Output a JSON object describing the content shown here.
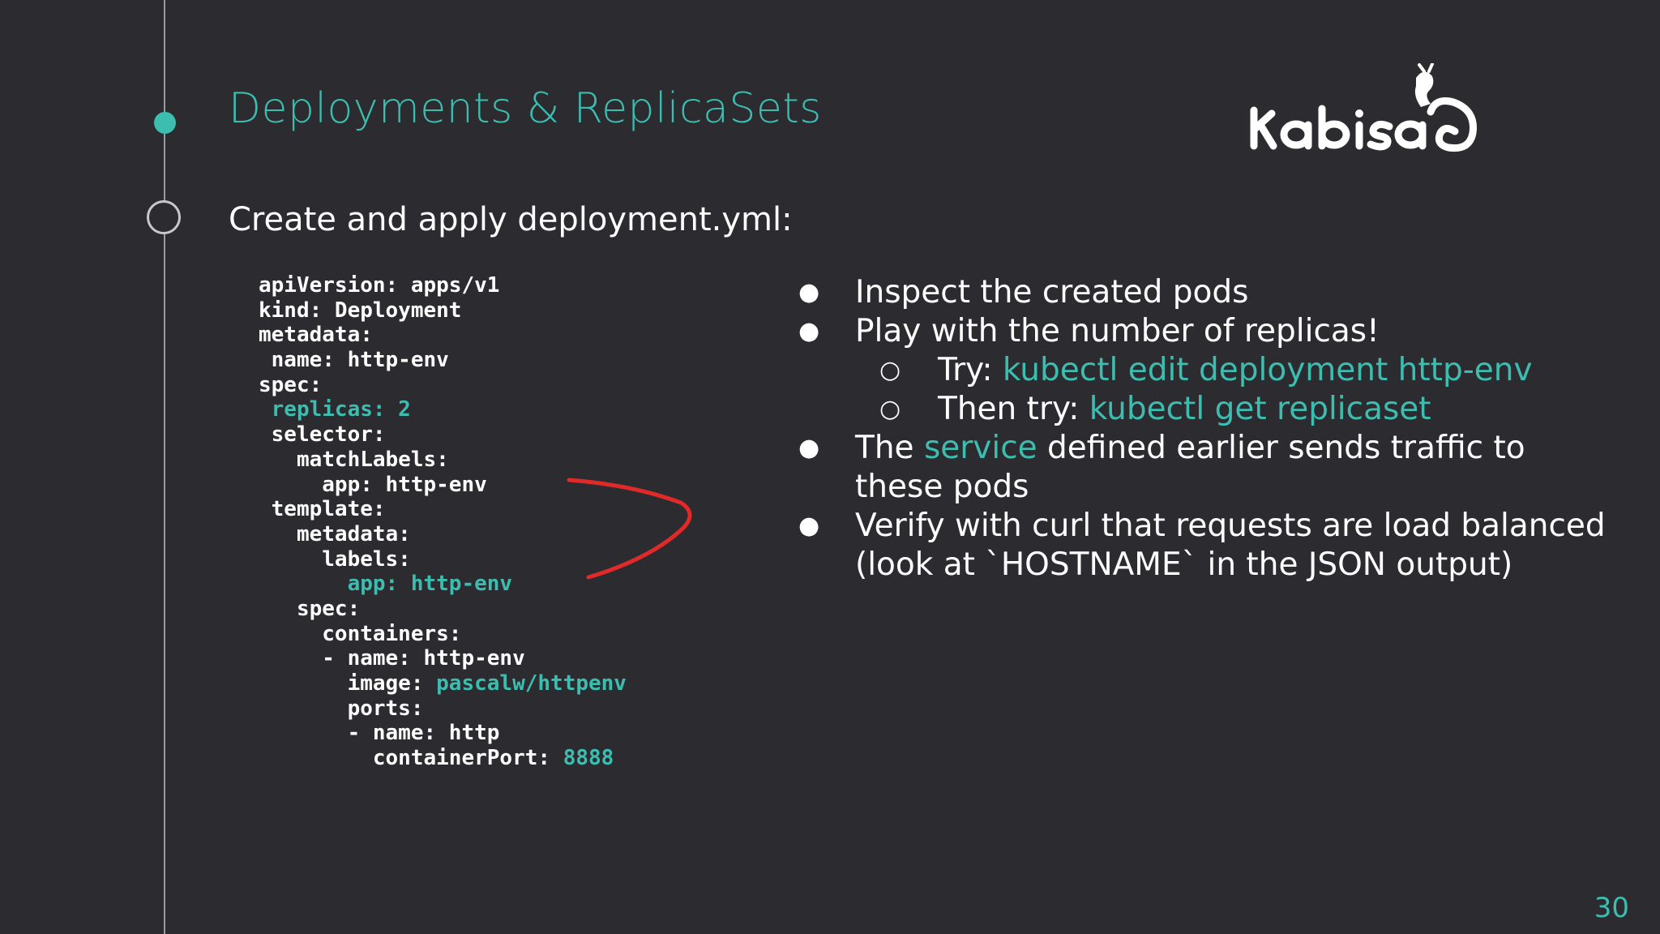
{
  "slide": {
    "title": "Deployments & ReplicaSets",
    "subtitle": "Create and apply deployment.yml:",
    "page_number": "30",
    "logo_text": "kabisa",
    "accent_color": "#3dbdb0",
    "background_color": "#2b2b30"
  },
  "code": {
    "line_1": "apiVersion: apps/v1",
    "line_2": "kind: Deployment",
    "line_3": "metadata:",
    "line_4": " name: http-env",
    "line_5": "spec:",
    "line_6": " replicas: 2",
    "line_7": " selector:",
    "line_8": "   matchLabels:",
    "line_9": "     app: http-env",
    "line_10": " template:",
    "line_11": "   metadata:",
    "line_12": "     labels:",
    "line_13": "       app: http-env",
    "line_14": "   spec:",
    "line_15": "     containers:",
    "line_16": "     - name: http-env",
    "line_17_key": "       image: ",
    "line_17_val": "pascalw/httpenv",
    "line_18": "       ports:",
    "line_19": "       - name: http",
    "line_20_key": "         containerPort: ",
    "line_20_val": "8888"
  },
  "bullets": {
    "marker": "●",
    "sub_marker": "○",
    "b1": "Inspect the created pods",
    "b2": "Play with the number of replicas!",
    "s1_prefix": "Try: ",
    "s1_cmd": "kubectl edit deployment http-env",
    "s2_prefix": "Then try: ",
    "s2_cmd": "kubectl get replicaset",
    "b3_pre": "The ",
    "b3_accent": "service",
    "b3_post": " defined earlier sends traffic to these pods",
    "b4": "Verify with curl that requests are load balanced (look at `HOSTNAME` in the JSON output)"
  }
}
